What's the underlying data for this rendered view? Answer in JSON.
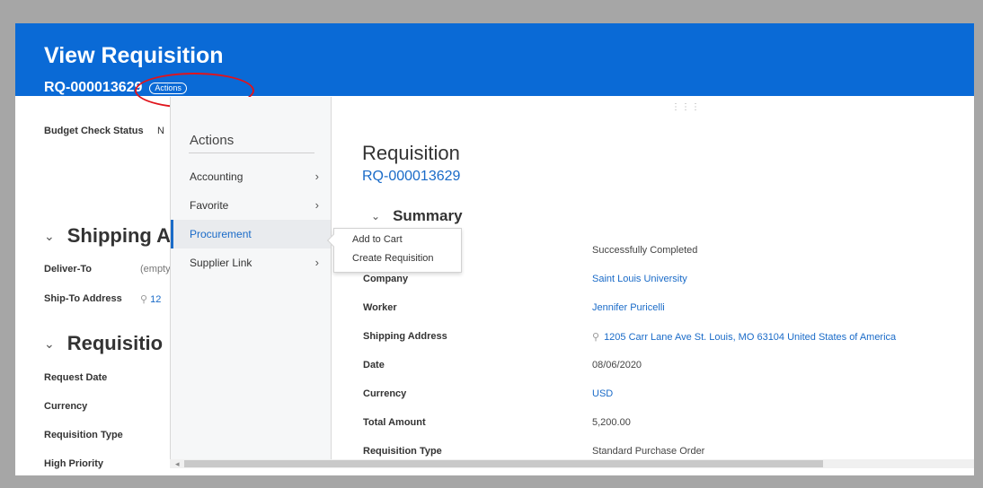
{
  "header": {
    "title": "View Requisition",
    "req_id": "RQ-000013629",
    "actions_label": "Actions"
  },
  "left_page": {
    "budget_check_label": "Budget Check Status",
    "budget_check_value": "N",
    "shipping_heading": "Shipping A",
    "deliver_to_label": "Deliver-To",
    "deliver_to_value": "(empty",
    "ship_to_label": "Ship-To Address",
    "ship_to_value": "12",
    "requisition_heading": "Requisitio",
    "fields": [
      "Request Date",
      "Currency",
      "Requisition Type",
      "High Priority"
    ]
  },
  "menu": {
    "title": "Actions",
    "items": [
      {
        "label": "Accounting",
        "has_submenu": true
      },
      {
        "label": "Favorite",
        "has_submenu": true
      },
      {
        "label": "Procurement",
        "has_submenu": false
      },
      {
        "label": "Supplier Link",
        "has_submenu": true
      }
    ],
    "active_item": "Procurement"
  },
  "flyout": {
    "items": [
      "Add to Cart",
      "Create Requisition"
    ]
  },
  "content": {
    "title": "Requisition",
    "req_id": "RQ-000013629",
    "summary_heading": "Summary",
    "status_value": "Successfully Completed",
    "rows": [
      {
        "label": "Company",
        "value": "Saint Louis University",
        "link": true
      },
      {
        "label": "Worker",
        "value": "Jennifer Puricelli",
        "link": true
      },
      {
        "label": "Shipping Address",
        "value": "1205 Carr Lane Ave St. Louis, MO 63104 United States of America",
        "link": true
      },
      {
        "label": "Date",
        "value": "08/06/2020",
        "link": false
      },
      {
        "label": "Currency",
        "value": "USD",
        "link": true
      },
      {
        "label": "Total Amount",
        "value": "5,200.00",
        "link": false
      },
      {
        "label": "Requisition Type",
        "value": "Standard Purchase Order",
        "link": false
      }
    ]
  },
  "colors": {
    "header_bg": "#0a6ad6",
    "link": "#1a6bc8",
    "highlight_oval": "#e0141c"
  },
  "icons": [
    "chevron-down-icon",
    "chevron-right-icon",
    "location-pin-icon",
    "drag-grip-icon"
  ]
}
